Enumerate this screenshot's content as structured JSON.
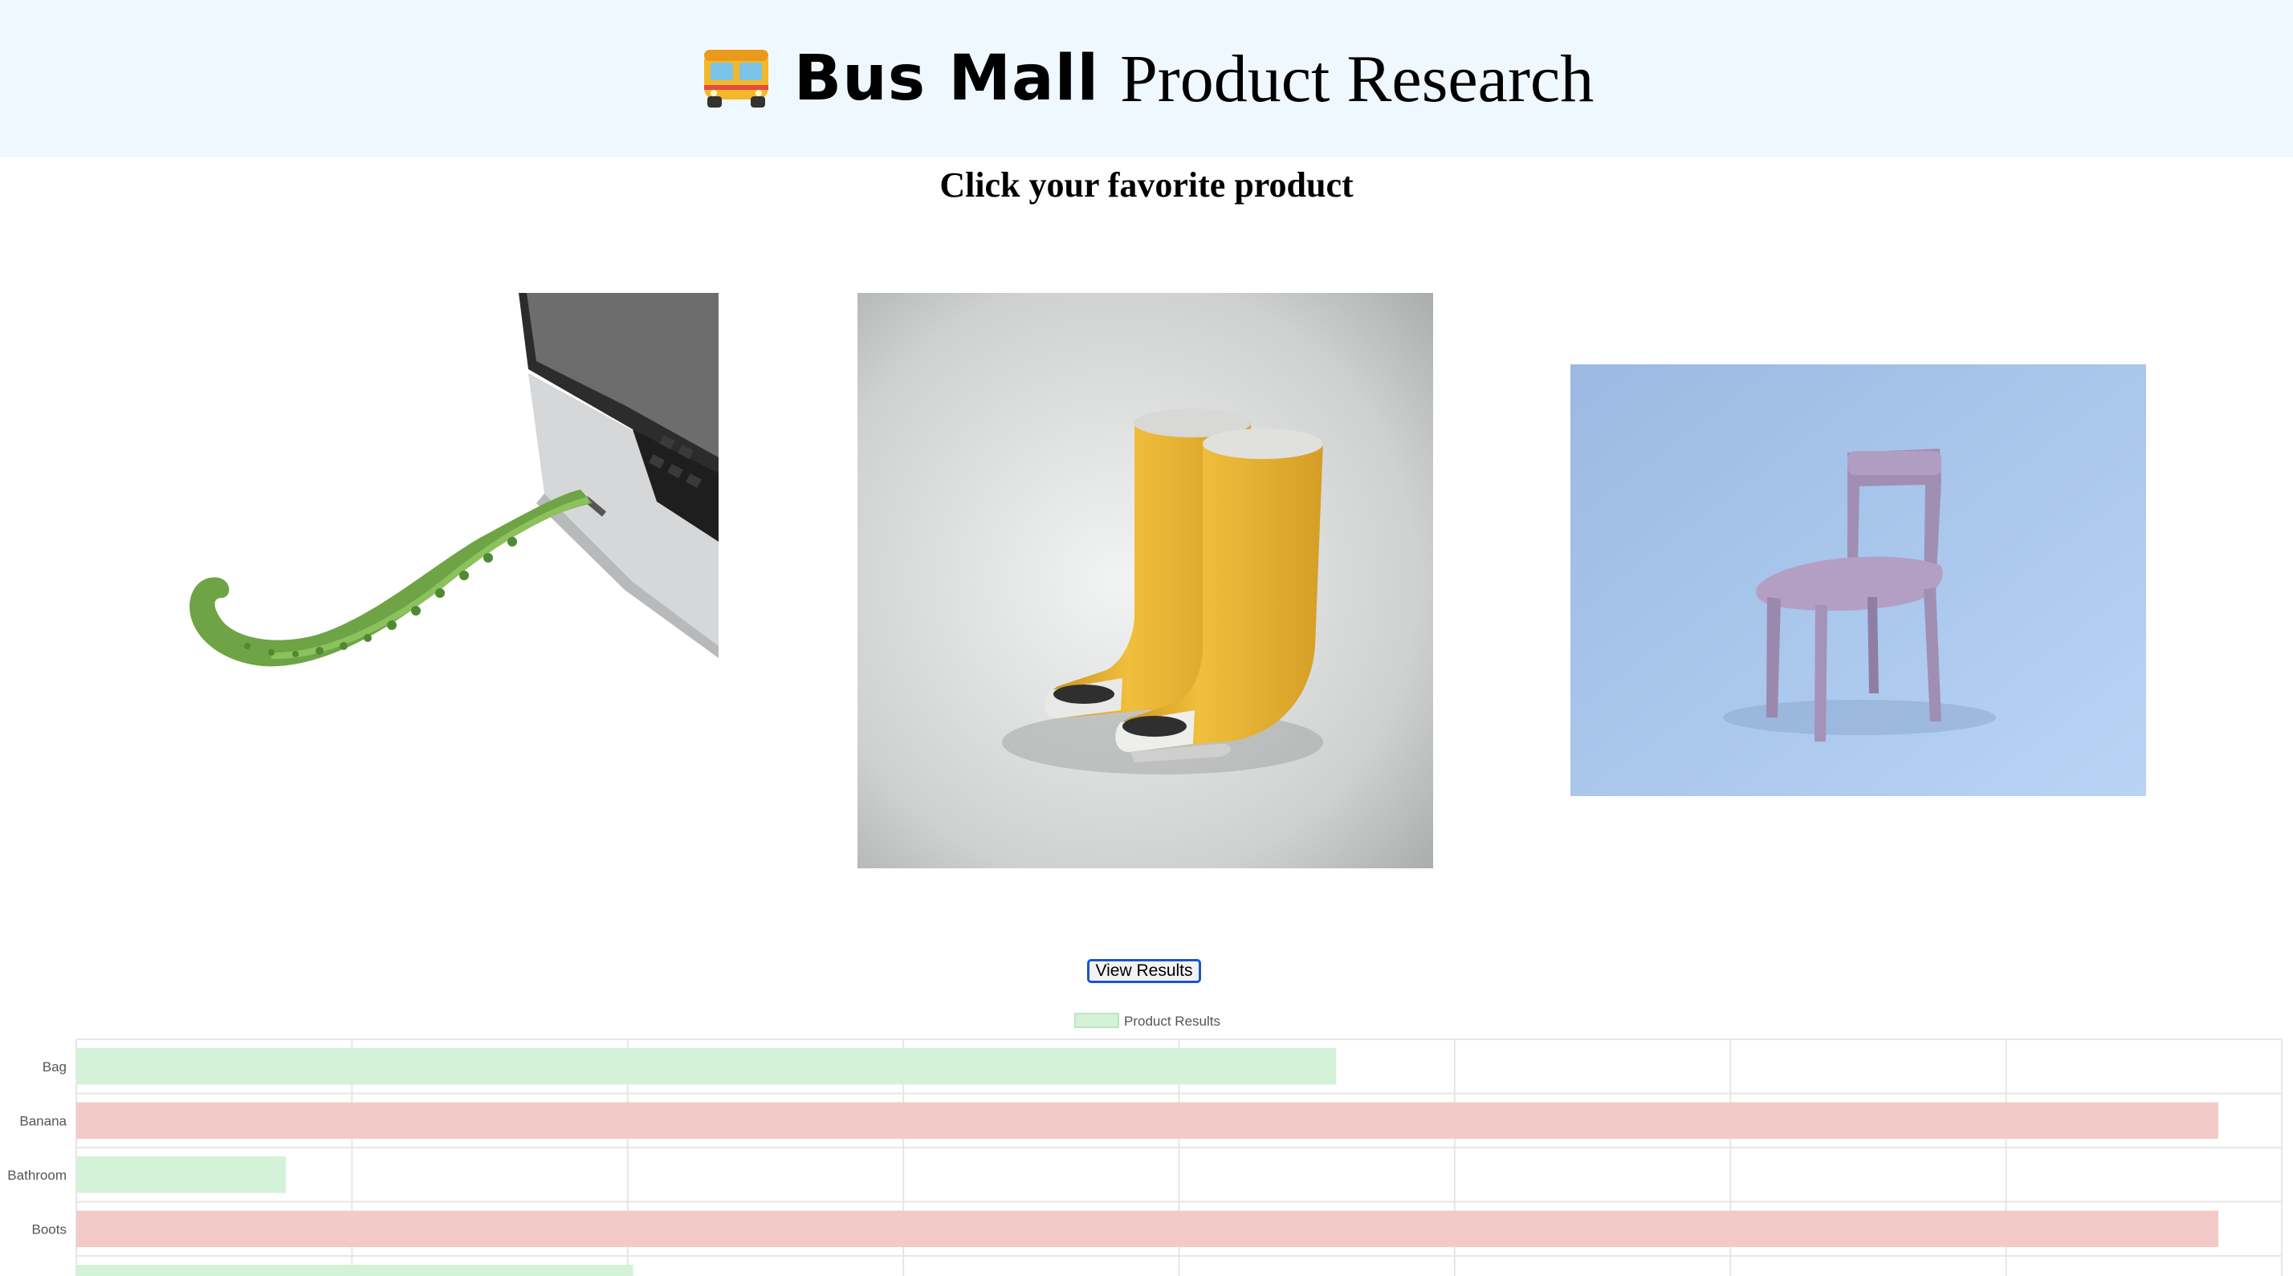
{
  "header": {
    "icon": "bus-icon",
    "brand": "Bus Mall",
    "title_rest": "Product Research"
  },
  "subtitle": "Click your favorite product",
  "products": [
    {
      "name": "usb",
      "icon": "tentacle-usb-image"
    },
    {
      "name": "boots",
      "icon": "yellow-boots-image"
    },
    {
      "name": "chair",
      "icon": "purple-chair-image"
    }
  ],
  "view_button": "View Results",
  "chart_data": {
    "type": "bar",
    "orientation": "horizontal",
    "legend": "Product Results",
    "legend_position": "top",
    "categories": [
      "Bag",
      "Banana",
      "Bathroom",
      "Boots",
      ""
    ],
    "values": [
      4.57,
      7.77,
      0.76,
      7.77,
      2.02
    ],
    "xlim": [
      0,
      8
    ],
    "grid": true,
    "colors": {
      "green_fill": "#d4f2d8",
      "red_fill": "#f2cbc9",
      "legend_border": "#b9e6c1"
    }
  }
}
